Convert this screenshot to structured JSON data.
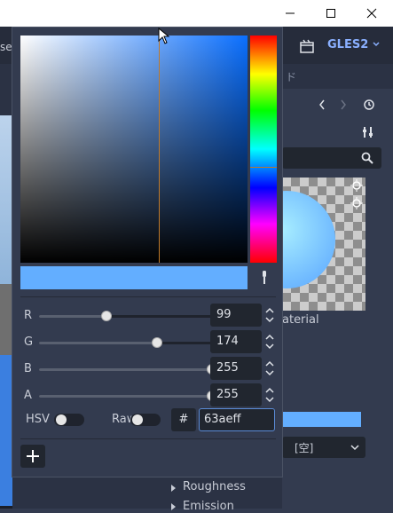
{
  "window": {
    "title_fragment": "se",
    "controls": [
      "minimize",
      "maximize",
      "close"
    ]
  },
  "editor": {
    "renderer": "GLES2",
    "tab_suffix": "ド",
    "material_label": "aterial",
    "albedo_color": "#63aeff",
    "texture_select": "[空]",
    "sections": [
      "Roughness",
      "Emission"
    ]
  },
  "color_picker": {
    "current_color": "#63aeff",
    "hue_color": "#0a6fff",
    "channels": [
      {
        "label": "R",
        "value": 99,
        "max": 255
      },
      {
        "label": "G",
        "value": 174,
        "max": 255
      },
      {
        "label": "B",
        "value": 255,
        "max": 255
      },
      {
        "label": "A",
        "value": 255,
        "max": 255
      }
    ],
    "channel_values": {
      "r": "99",
      "g": "174",
      "b": "255",
      "a": "255"
    },
    "hsv_label": "HSV",
    "hsv_enabled": false,
    "raw_label": "Raw",
    "raw_enabled": false,
    "hash_label": "#",
    "hex_value": "63aeff",
    "add_preset_icon": "plus-icon"
  }
}
